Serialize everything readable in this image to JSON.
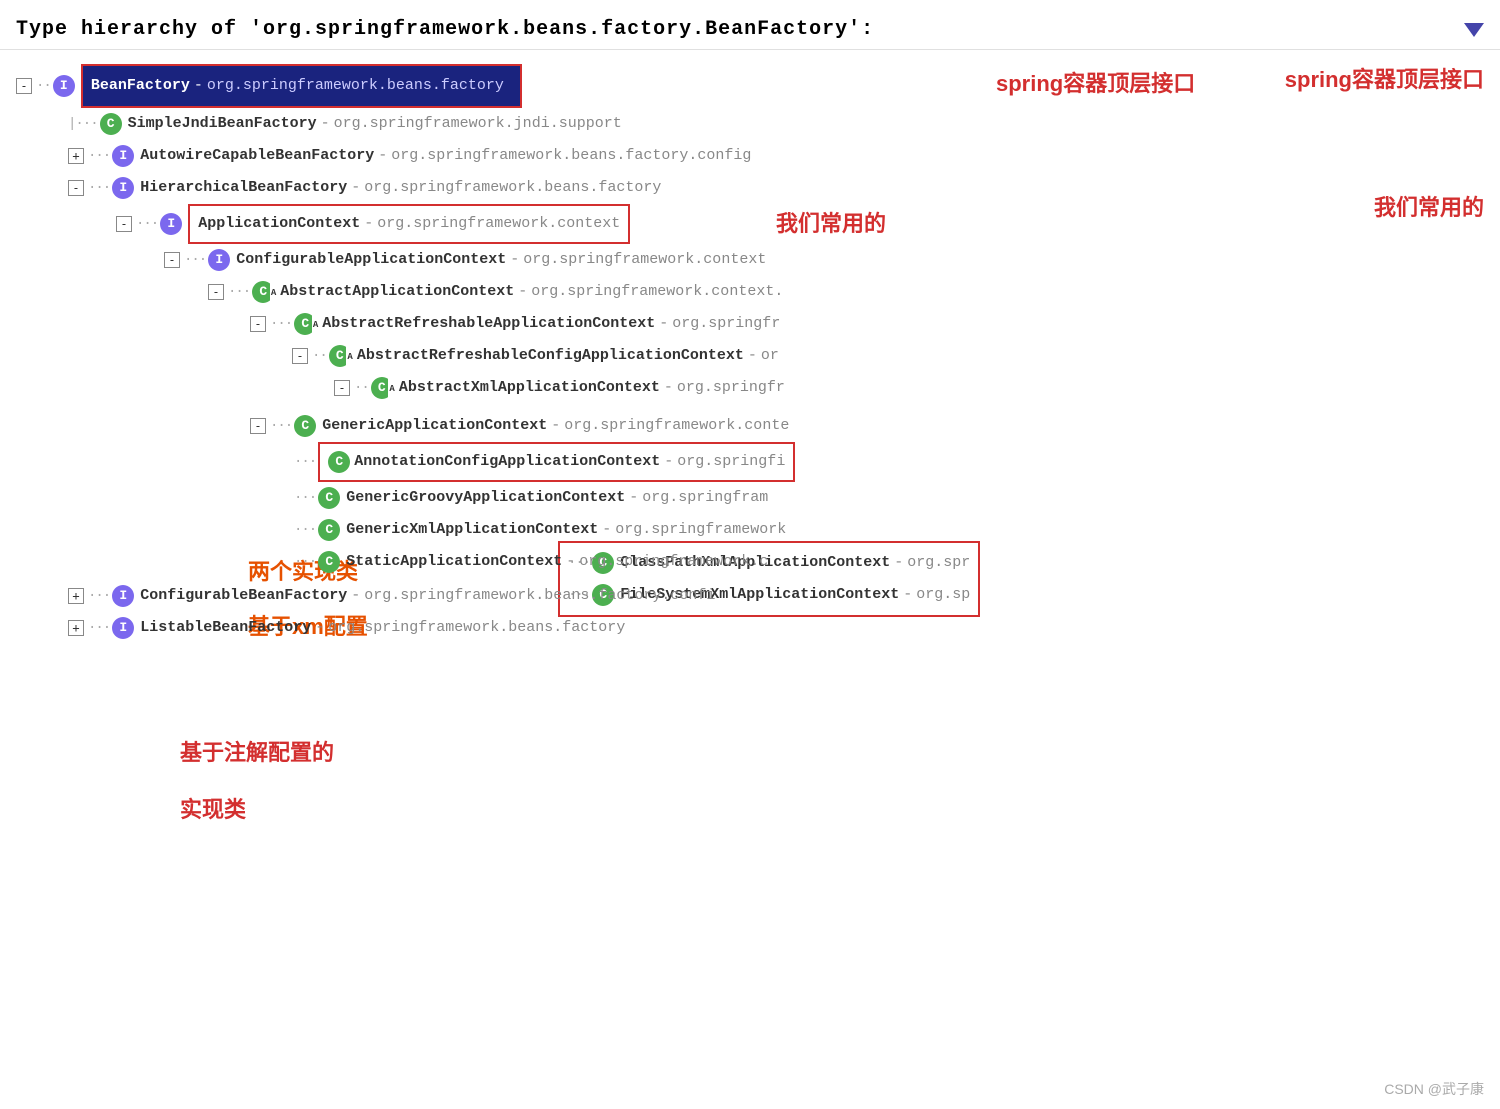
{
  "title": {
    "text": "Type hierarchy of 'org.springframework.beans.factory.BeanFactory':",
    "dropdown_symbol": "▼"
  },
  "annotations": {
    "spring_top_interface": "spring容器顶层接口",
    "common_used": "我们常用的",
    "two_impl_xml": "两个实现类\n基于xm配置",
    "annotation_based": "基于注解配置的\n实现类"
  },
  "tree": [
    {
      "id": "bean-factory",
      "indent": 0,
      "expand": "-",
      "icon_type": "interface",
      "name": "BeanFactory",
      "package": "org.springframework.beans.factory",
      "highlighted": true,
      "boxed_red": false,
      "connector": ""
    },
    {
      "id": "simple-jndi",
      "indent": 1,
      "expand": null,
      "icon_type": "class",
      "name": "SimpleJndiBeanFactory",
      "package": "org.springframework.jndi.support",
      "connector": "dots"
    },
    {
      "id": "autowire-capable",
      "indent": 1,
      "expand": "+",
      "icon_type": "interface",
      "name": "AutowireCapableBeanFactory",
      "package": "org.springframework.beans.factory.config",
      "connector": "dots"
    },
    {
      "id": "hierarchical",
      "indent": 1,
      "expand": "-",
      "icon_type": "interface",
      "name": "HierarchicalBeanFactory",
      "package": "org.springframework.beans.factory",
      "connector": "dots"
    },
    {
      "id": "application-context",
      "indent": 2,
      "expand": "-",
      "icon_type": "interface",
      "name": "ApplicationContext",
      "package": "org.springframework.context",
      "boxed_red": true,
      "connector": "dots"
    },
    {
      "id": "configurable-app-ctx",
      "indent": 3,
      "expand": "-",
      "icon_type": "interface",
      "name": "ConfigurableApplicationContext",
      "package": "org.springframework.context",
      "connector": "dots"
    },
    {
      "id": "abstract-app-ctx",
      "indent": 4,
      "expand": "-",
      "icon_type": "abstract_class",
      "name": "AbstractApplicationContext",
      "package": "org.springframework.context",
      "connector": "dots"
    },
    {
      "id": "abstract-refreshable",
      "indent": 5,
      "expand": "-",
      "icon_type": "abstract_class",
      "name": "AbstractRefreshableApplicationContext",
      "package": "org.springframework.context",
      "connector": "dots"
    },
    {
      "id": "abstract-refreshable-config",
      "indent": 6,
      "expand": "-",
      "icon_type": "abstract_class",
      "name": "AbstractRefreshableConfigApplicationContext",
      "package": "or",
      "connector": "dots"
    },
    {
      "id": "abstract-xml",
      "indent": 7,
      "expand": "-",
      "icon_type": "abstract_class",
      "name": "AbstractXmlApplicationContext",
      "package": "org.springframework",
      "connector": "dots"
    },
    {
      "id": "classpath-xml",
      "indent": 8,
      "expand": null,
      "icon_type": "class",
      "name": "ClassPathXmlApplicationContext",
      "package": "org.spr",
      "boxed_red": true,
      "connector": "dots"
    },
    {
      "id": "filesystem-xml",
      "indent": 8,
      "expand": null,
      "icon_type": "class",
      "name": "FileSystemXmlApplicationContext",
      "package": "org.sp",
      "boxed_red": true,
      "connector": "dots"
    },
    {
      "id": "generic-app-ctx",
      "indent": 5,
      "expand": "-",
      "icon_type": "class",
      "name": "GenericApplicationContext",
      "package": "org.springframework.conte",
      "connector": "dots"
    },
    {
      "id": "annotation-config",
      "indent": 6,
      "expand": null,
      "icon_type": "class",
      "name": "AnnotationConfigApplicationContext",
      "package": "org.springfi",
      "boxed_red": true,
      "connector": "dots"
    },
    {
      "id": "generic-groovy",
      "indent": 6,
      "expand": null,
      "icon_type": "class",
      "name": "GenericGroovyApplicationContext",
      "package": "org.springfram",
      "connector": "dots"
    },
    {
      "id": "generic-xml",
      "indent": 6,
      "expand": null,
      "icon_type": "class",
      "name": "GenericXmlApplicationContext",
      "package": "org.springframework",
      "connector": "dots"
    },
    {
      "id": "static-app-ctx",
      "indent": 6,
      "expand": null,
      "icon_type": "class",
      "name": "StaticApplicationContext",
      "package": "org.springframework.c",
      "connector": "dots"
    },
    {
      "id": "configurable-bf",
      "indent": 1,
      "expand": "+",
      "icon_type": "interface",
      "name": "ConfigurableBeanFactory",
      "package": "org.springframework.beans.factory.confi",
      "connector": "dots"
    },
    {
      "id": "listable-bf",
      "indent": 1,
      "expand": "+",
      "icon_type": "interface",
      "name": "ListableBeanFactory",
      "package": "org.springframework.beans.factory",
      "connector": "dots"
    }
  ],
  "watermark": "CSDN @武子康"
}
